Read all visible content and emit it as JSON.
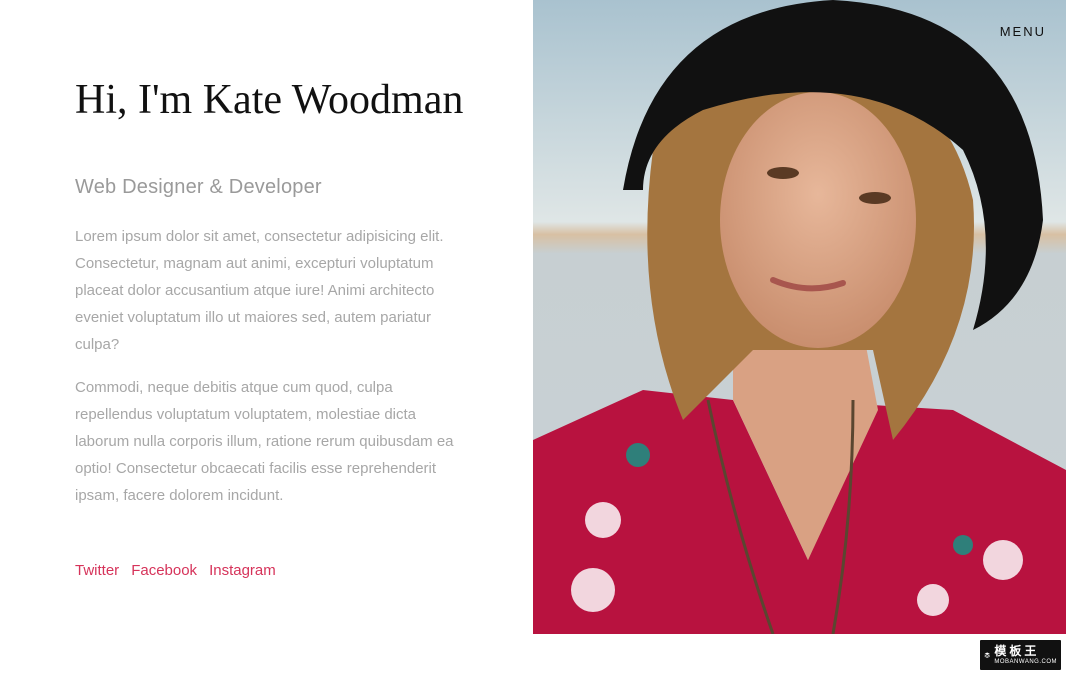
{
  "header": {
    "menu_label": "MENU"
  },
  "hero": {
    "title": "Hi, I'm Kate Woodman",
    "subtitle": "Web Designer & Developer",
    "paragraphs": [
      "Lorem ipsum dolor sit amet, consectetur adipisicing elit. Consectetur, magnam aut animi, excepturi voluptatum placeat dolor accusantium atque iure! Animi architecto eveniet voluptatum illo ut maiores sed, autem pariatur culpa?",
      "Commodi, neque debitis atque cum quod, culpa repellendus voluptatum voluptatem, molestiae dicta laborum nulla corporis illum, ratione rerum quibusdam ea optio! Consectetur obcaecati facilis esse reprehenderit ipsam, facere dolorem incidunt."
    ]
  },
  "social": {
    "links": [
      "Twitter",
      "Facebook",
      "Instagram"
    ]
  },
  "watermark": {
    "line1": "模板王",
    "line2": "MOBANWANG.COM"
  },
  "colors": {
    "accent": "#d6335a",
    "text": "#111111",
    "muted": "#a7a7a7"
  },
  "icons": {
    "portrait": "portrait-photo",
    "watermark": "moban-logo-icon"
  }
}
